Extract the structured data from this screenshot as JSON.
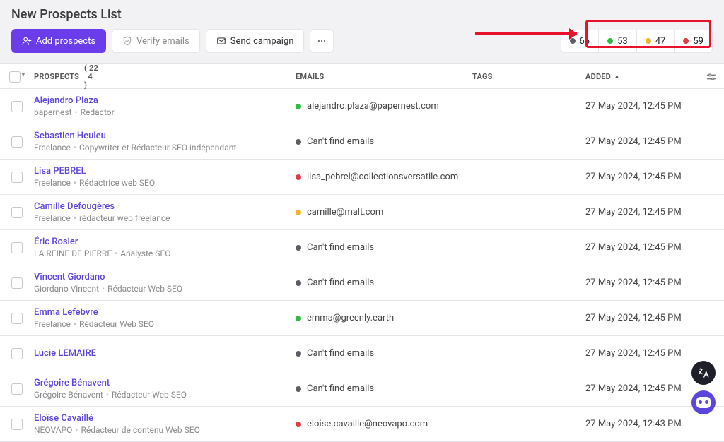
{
  "title": "New Prospects List",
  "toolbar": {
    "add_label": "Add prospects",
    "verify_label": "Verify emails",
    "send_label": "Send campaign"
  },
  "status_counts": {
    "dark": "66",
    "green": "53",
    "yellow": "47",
    "red": "59"
  },
  "columns": {
    "prospects_label": "PROSPECTS",
    "prospects_count_top": "22",
    "prospects_count_bottom": "4",
    "emails": "EMAILS",
    "tags": "TAGS",
    "added": "ADDED"
  },
  "cant_find": "Can't find emails",
  "rows": [
    {
      "name": "Alejandro Plaza",
      "company": "papernest",
      "role": "Redactor",
      "email": "alejandro.plaza@papernest.com",
      "status": "green",
      "added": "27 May 2024, 12:45 PM"
    },
    {
      "name": "Sebastien Heuleu",
      "company": "Freelance",
      "role": "Copywriter et Rédacteur SEO indépendant",
      "email": "",
      "status": "dark",
      "added": "27 May 2024, 12:45 PM"
    },
    {
      "name": "Lisa PEBREL",
      "company": "Freelance",
      "role": "Rédactrice web SEO",
      "email": "lisa_pebrel@collectionsversatile.com",
      "status": "red",
      "added": "27 May 2024, 12:45 PM"
    },
    {
      "name": "Camille Defougères",
      "company": "Freelance",
      "role": "rédacteur web freelance",
      "email": "camille@malt.com",
      "status": "yellow",
      "added": "27 May 2024, 12:45 PM"
    },
    {
      "name": "Éric Rosier",
      "company": "LA REINE DE PIERRE",
      "role": "Analyste SEO",
      "email": "",
      "status": "dark",
      "added": "27 May 2024, 12:45 PM"
    },
    {
      "name": "Vincent Giordano",
      "company": "Giordano Vincent",
      "role": "Rédacteur Web SEO",
      "email": "",
      "status": "dark",
      "added": "27 May 2024, 12:45 PM"
    },
    {
      "name": "Emma Lefebvre",
      "company": "Freelance",
      "role": "Rédacteur Web SEO",
      "email": "emma@greenly.earth",
      "status": "green",
      "added": "27 May 2024, 12:45 PM"
    },
    {
      "name": "Lucie LEMAIRE",
      "company": "",
      "role": "",
      "email": "",
      "status": "dark",
      "added": "27 May 2024, 12:45 PM"
    },
    {
      "name": "Grégoire Bénavent",
      "company": "Grégoire Bénavent",
      "role": "Rédacteur Web SEO",
      "email": "",
      "status": "dark",
      "added": "27 May 2024, 12:45 PM"
    },
    {
      "name": "Eloïse Cavaillé",
      "company": "NEOVAPO",
      "role": "Rédacteur de contenu Web SEO",
      "email": "eloise.cavaille@neovapo.com",
      "status": "red",
      "added": "27 May 2024, 12:43 PM"
    }
  ]
}
